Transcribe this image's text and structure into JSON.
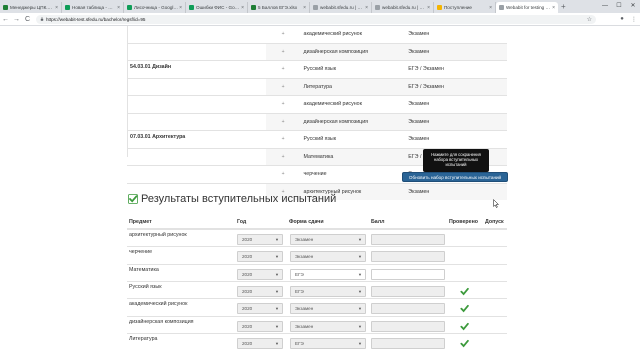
{
  "browser": {
    "tabs": [
      {
        "label": "Менеджеры ЦПК.xlsx",
        "fav": "#1e7e34"
      },
      {
        "label": "Новая таблица - Goo...",
        "fav": "#0f9d58"
      },
      {
        "label": "Лисочница - Google...",
        "fav": "#0f9d58"
      },
      {
        "label": "Ошибки ФИС - Goog...",
        "fav": "#0f9d58"
      },
      {
        "label": "5 Баллов ЕГЭ.xlsx",
        "fav": "#1e7e34"
      },
      {
        "label": "webabit.sfedu.ru | Пр...",
        "fav": "#9aa0a6"
      },
      {
        "label": "webabit.sfedu.ru | Пр...",
        "fav": "#9aa0a6"
      },
      {
        "label": "Поступление",
        "fav": "#f4b400"
      },
      {
        "label": "Webabit for testing | ...",
        "fav": "#9aa0a6",
        "active": true
      }
    ],
    "url": "https://webabit-test.sfedu.ru/bachelor/regsf/id=95",
    "new_tab": "+",
    "win_min": "—",
    "win_max": "☐",
    "win_close": "✕",
    "back": "←",
    "forward": "→",
    "reload": "C"
  },
  "programs": {
    "rows": [
      {
        "program": "",
        "plus": "+",
        "subject": "академический рисунок",
        "form": "Экзамен",
        "shade": false,
        "top": true
      },
      {
        "program": "",
        "plus": "+",
        "subject": "дизайнерская композиция",
        "form": "Экзамен",
        "shade": true
      },
      {
        "program": "54.03.01 Дизайн",
        "plus": "+",
        "subject": "Русский язык",
        "form": "ЕГЭ / Экзамен",
        "shade": false
      },
      {
        "program": "",
        "plus": "+",
        "subject": "Литература",
        "form": "ЕГЭ / Экзамен",
        "shade": true
      },
      {
        "program": "",
        "plus": "+",
        "subject": "академический рисунок",
        "form": "Экзамен",
        "shade": false
      },
      {
        "program": "",
        "plus": "+",
        "subject": "дизайнерская композиция",
        "form": "Экзамен",
        "shade": true
      },
      {
        "program": "07.03.01 Архитектура",
        "plus": "+",
        "subject": "Русский язык",
        "form": "Экзамен",
        "shade": false
      },
      {
        "program": "",
        "plus": "+",
        "subject": "Математика",
        "form": "ЕГЭ / Экзамен",
        "shade": true
      },
      {
        "program": "",
        "plus": "+",
        "subject": "черчение",
        "form": "Экзамен",
        "shade": false
      },
      {
        "program": "",
        "plus": "+",
        "subject": "архитектурный рисунок",
        "form": "Экзамен",
        "shade": true
      }
    ]
  },
  "tooltip": {
    "line1": "Нажмите для сохранения",
    "line2": "набора вступительных",
    "line3": "испытаний"
  },
  "update_button": "Обновить набор вступительных испытаний",
  "results": {
    "title": "Результаты вступительных испытаний",
    "check_color": "#3c9a3c",
    "headers": {
      "subject": "Предмет",
      "year": "Год",
      "form": "Форма сдачи",
      "score": "Балл",
      "verified": "Проверено",
      "admission": "Допуск"
    },
    "rows": [
      {
        "subject": "архитектурный рисунок",
        "year": "2020",
        "form": "Экзамен",
        "form_light": false,
        "score_white": false,
        "verified": false
      },
      {
        "subject": "черчение",
        "year": "2020",
        "form": "Экзамен",
        "form_light": false,
        "score_white": false,
        "verified": false
      },
      {
        "subject": "Математика",
        "year": "2020",
        "form": "ЕГЭ",
        "form_light": true,
        "score_white": true,
        "verified": false
      },
      {
        "subject": "Русский язык",
        "year": "2020",
        "form": "ЕГЭ",
        "form_light": false,
        "score_white": false,
        "verified": true
      },
      {
        "subject": "академический рисунок",
        "year": "2020",
        "form": "Экзамен",
        "form_light": false,
        "score_white": false,
        "verified": true
      },
      {
        "subject": "дизайнерская композиция",
        "year": "2020",
        "form": "Экзамен",
        "form_light": false,
        "score_white": false,
        "verified": true
      },
      {
        "subject": "Литература",
        "year": "2020",
        "form": "ЕГЭ",
        "form_light": false,
        "score_white": false,
        "verified": true
      }
    ]
  }
}
